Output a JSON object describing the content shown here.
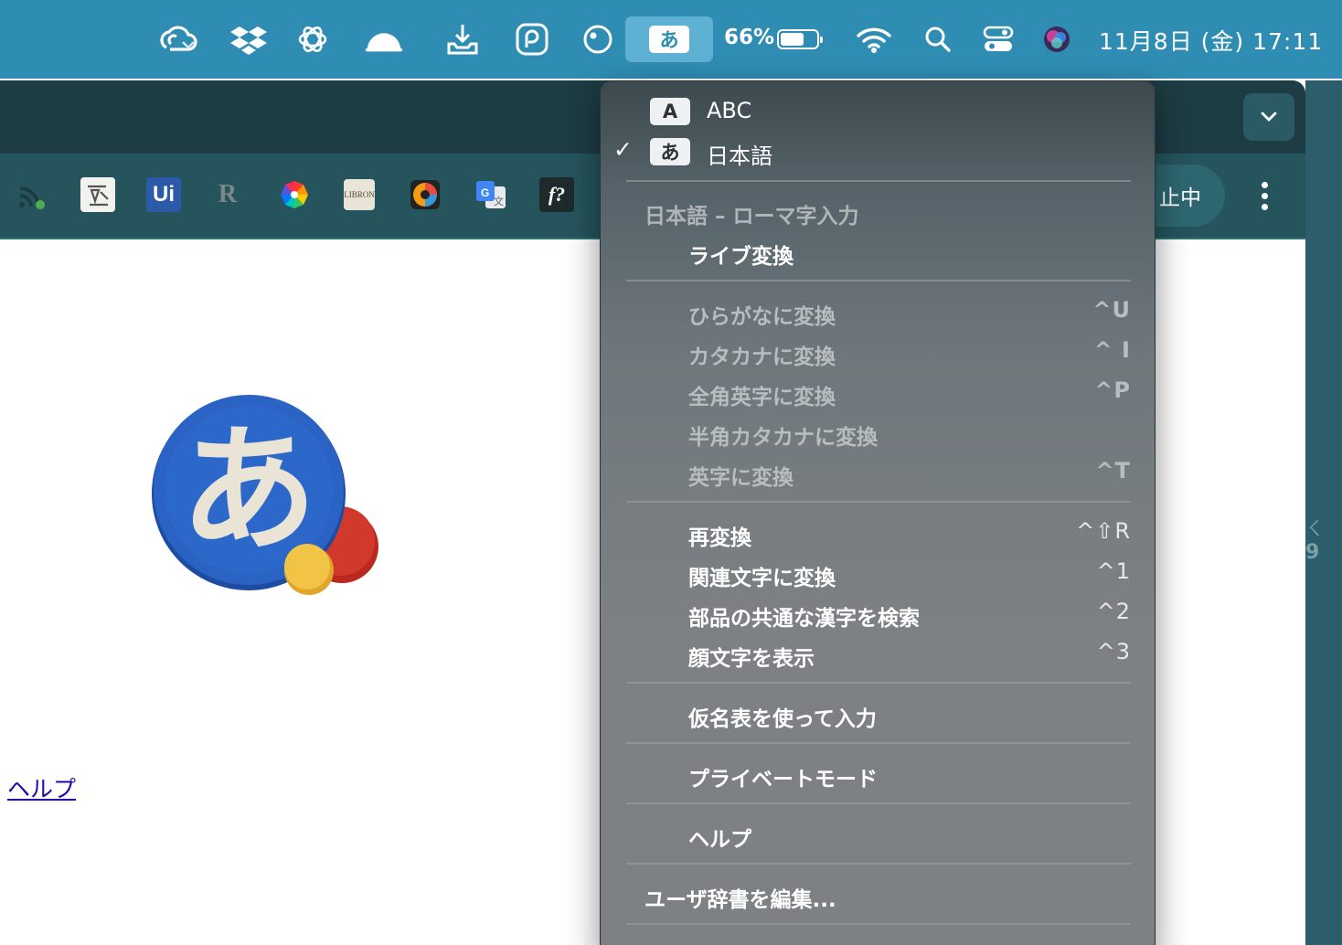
{
  "menubar": {
    "ime_indicator": "あ",
    "battery_percent_text": "66%",
    "battery_level": 0.66,
    "clock": "11月8日 (金)  17:11",
    "icons": [
      "creative-cloud-icon",
      "dropbox-icon",
      "chatgpt-icon",
      "cloud-icon",
      "download-icon",
      "pcloud-icon",
      "circle-status-icon",
      "wifi-icon",
      "search-icon",
      "control-center-icon",
      "siri-icon"
    ]
  },
  "browser": {
    "pause_label": "止中",
    "extensions": [
      "rss-extension-icon",
      "pin-extension-icon",
      "ui-extension-icon",
      "r-extension-icon",
      "color-wheel-extension-icon",
      "libron-extension-icon",
      "palette-extension-icon",
      "google-translate-extension-icon",
      "font-extension-icon"
    ],
    "ui_ext_label": "Ui",
    "r_ext_label": "R",
    "libron_label": "LIBRON",
    "font_ext_label": "f?"
  },
  "page": {
    "logo_char": "あ",
    "help_link": "ヘルプ"
  },
  "menu": {
    "input_sources": [
      {
        "chip": "A",
        "label": "ABC",
        "checked": false
      },
      {
        "chip": "あ",
        "label": "日本語",
        "checked": true
      }
    ],
    "check_mark": "✓",
    "section_header": "日本語 – ローマ字入力",
    "live_conversion": "ライブ変換",
    "convert_items": [
      {
        "label": "ひらがなに変換",
        "shortcut": "^U"
      },
      {
        "label": "カタカナに変換",
        "shortcut": "^ I"
      },
      {
        "label": "全角英字に変換",
        "shortcut": "^P"
      },
      {
        "label": "半角カタカナに変換",
        "shortcut": ""
      },
      {
        "label": "英字に変換",
        "shortcut": "^T"
      }
    ],
    "tool_items": [
      {
        "label": "再変換",
        "shortcut": "^⇧R"
      },
      {
        "label": "関連文字に変換",
        "shortcut": "^1"
      },
      {
        "label": "部品の共通な漢字を検索",
        "shortcut": "^2"
      },
      {
        "label": "顔文字を表示",
        "shortcut": "^3"
      }
    ],
    "kana_table": "仮名表を使って入力",
    "private_mode": "プライベートモード",
    "help": "ヘルプ",
    "edit_dictionary": "ユーザ辞書を編集..."
  },
  "colors": {
    "menubar": "#2f8db3",
    "ime_highlight": "#5fb1d3",
    "browser_dark": "#1d3c44",
    "toolbar": "#25545d",
    "menu_gray": "#7e8183",
    "link": "#1a0dab",
    "logo_blue": "#2a63c4",
    "logo_red": "#c3301f",
    "logo_yellow": "#f2c445"
  }
}
